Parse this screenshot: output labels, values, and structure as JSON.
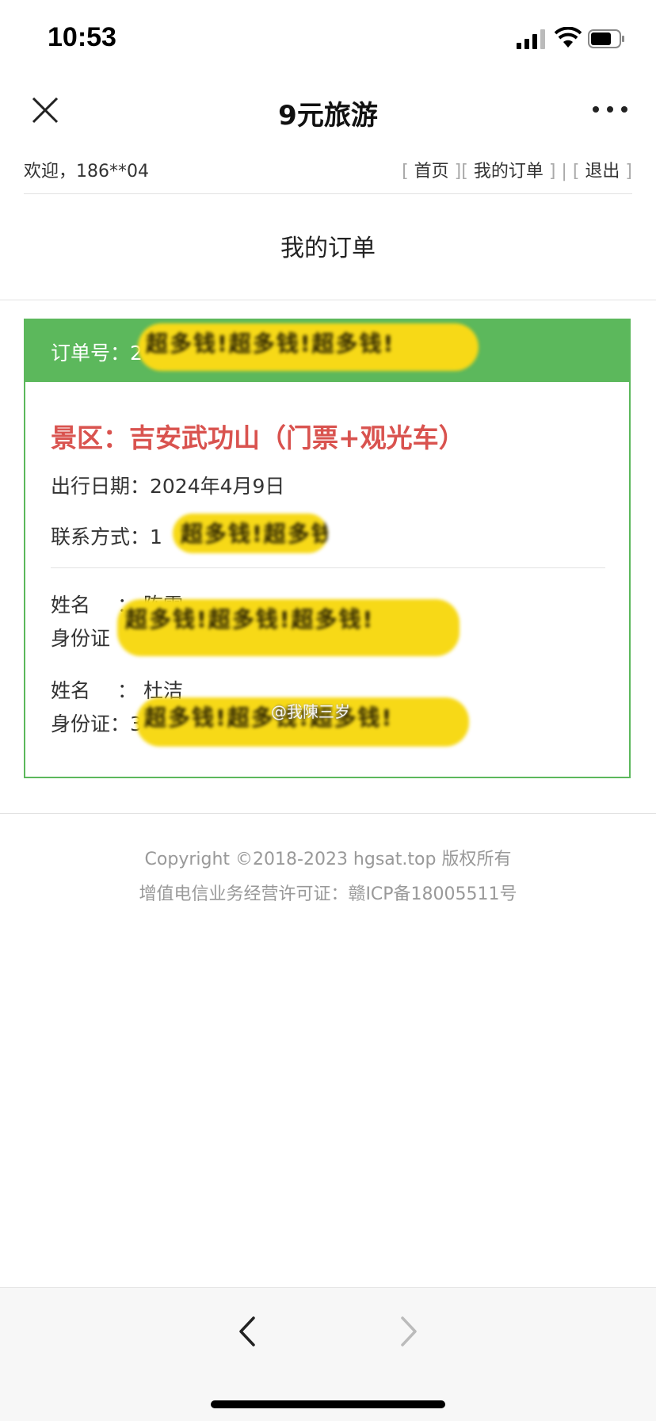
{
  "status_bar": {
    "time": "10:53"
  },
  "nav": {
    "title": "9元旅游"
  },
  "top_bar": {
    "welcome": "欢迎，186**04",
    "links": [
      "首页",
      "我的订单",
      "退出"
    ]
  },
  "page_title": "我的订单",
  "order": {
    "order_no_label": "订单号：",
    "order_no_visible": "2",
    "scenic": "景区：吉安武功山（门票+观光车）",
    "travel_date": "出行日期：2024年4月9日",
    "contact_label": "联系方式：",
    "contact_visible": "1",
    "passengers": [
      {
        "name_label": "姓名",
        "name": "陈雯",
        "id_label": "身份证"
      },
      {
        "name_label": "姓名",
        "name": "杜洁",
        "id_label": "身份证：",
        "id_visible": "3"
      }
    ],
    "redaction_text": "超多钱!超多钱!超多钱!"
  },
  "watermark": "@我陳三岁",
  "footer": {
    "copyright": "Copyright ©2018-2023 hgsat.top 版权所有",
    "icp": "增值电信业务经营许可证：赣ICP备18005511号"
  },
  "colors": {
    "accent_green": "#5cb85c",
    "scenic_red": "#d9534f",
    "redaction_yellow": "#f7d917"
  }
}
